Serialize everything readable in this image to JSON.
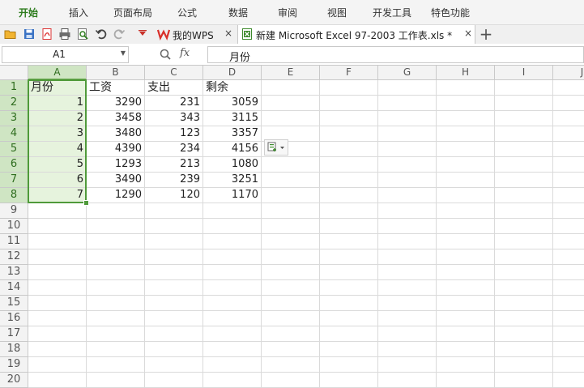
{
  "menu": {
    "items": [
      {
        "label": "开始",
        "active": true
      },
      {
        "label": "插入"
      },
      {
        "label": "页面布局"
      },
      {
        "label": "公式"
      },
      {
        "label": "数据"
      },
      {
        "label": "审阅"
      },
      {
        "label": "视图"
      },
      {
        "label": "开发工具"
      },
      {
        "label": "特色功能"
      }
    ]
  },
  "tabs": {
    "wps_label": "我的WPS",
    "doc_label": "新建 Microsoft Excel 97-2003 工作表.xls *",
    "close_glyph": "×",
    "add_glyph": "+"
  },
  "formula_bar": {
    "name_box": "A1",
    "fx": "fx",
    "content": "月份"
  },
  "sheet": {
    "columns": [
      "A",
      "B",
      "C",
      "D",
      "E",
      "F",
      "G",
      "H",
      "I",
      "J"
    ],
    "rows": [
      "1",
      "2",
      "3",
      "4",
      "5",
      "6",
      "7",
      "8",
      "9",
      "10",
      "11",
      "12",
      "13",
      "14",
      "15",
      "16",
      "17",
      "18",
      "19",
      "20"
    ],
    "headers": [
      "月份",
      "工资",
      "支出",
      "剩余"
    ],
    "data": [
      [
        "1",
        "3290",
        "231",
        "3059"
      ],
      [
        "2",
        "3458",
        "343",
        "3115"
      ],
      [
        "3",
        "3480",
        "123",
        "3357"
      ],
      [
        "4",
        "4390",
        "234",
        "4156"
      ],
      [
        "5",
        "1293",
        "213",
        "1080"
      ],
      [
        "6",
        "3490",
        "239",
        "3251"
      ],
      [
        "7",
        "1290",
        "120",
        "1170"
      ]
    ]
  },
  "colors": {
    "accent": "#4f9a3a",
    "selection_fill": "#e6f3dd",
    "wps_red": "#d9302a"
  },
  "icons": [
    "open-folder-icon",
    "save-icon",
    "pdf-icon",
    "print-icon",
    "print-preview-icon",
    "undo-icon",
    "redo-icon",
    "customize-dropdown-icon",
    "wps-logo-icon",
    "excel-doc-icon",
    "zoom-icon",
    "paste-options-icon"
  ]
}
